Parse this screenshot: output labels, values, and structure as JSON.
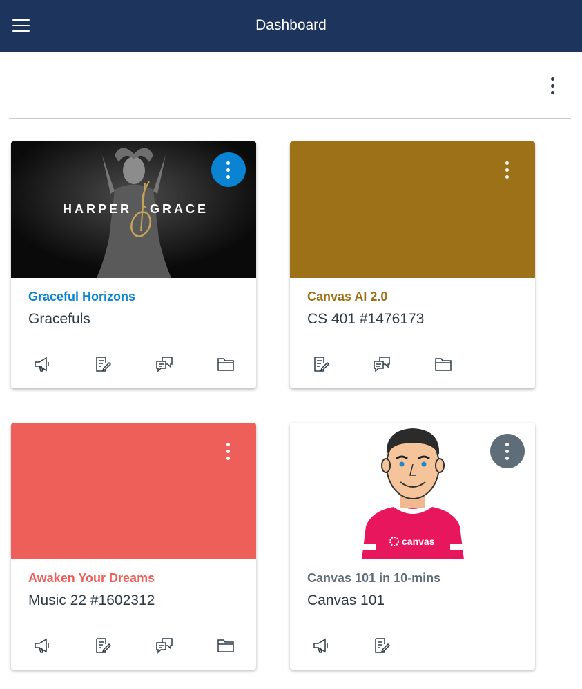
{
  "header": {
    "title": "Dashboard",
    "menu_icon": "hamburger-icon",
    "background": "#1d355c"
  },
  "page_options_icon": "kebab-icon",
  "courses": [
    {
      "title": "Graceful Horizons",
      "subtitle": "Gracefuls",
      "color": "#0b83d3",
      "hero": "image",
      "hero_logo_text": {
        "left": "HARPER",
        "right": "GRACE"
      },
      "menu_style": "blue-circle",
      "actions": [
        "announcements-icon",
        "assignments-icon",
        "discussions-icon",
        "files-icon"
      ]
    },
    {
      "title": "Canvas AI 2.0",
      "subtitle": "CS 401 #1476173",
      "color": "#9c7117",
      "hero": "solid",
      "menu_style": "plain",
      "actions": [
        "assignments-icon",
        "discussions-icon",
        "files-icon"
      ]
    },
    {
      "title": "Awaken Your Dreams",
      "subtitle": "Music 22 #1602312",
      "color": "#ee5f59",
      "hero": "solid",
      "menu_style": "plain",
      "actions": [
        "announcements-icon",
        "assignments-icon",
        "discussions-icon",
        "files-icon"
      ]
    },
    {
      "title": "Canvas 101 in 10-mins",
      "subtitle": "Canvas 101",
      "color": "#5f6d79",
      "hero": "image",
      "hero_shirt_text": "canvas",
      "menu_style": "gray-circle",
      "actions": [
        "announcements-icon",
        "assignments-icon"
      ]
    }
  ]
}
